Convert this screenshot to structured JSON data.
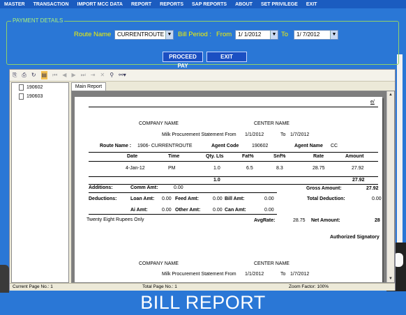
{
  "menu": [
    "MASTER",
    "TRANSACTION",
    "IMPORT MCC DATA",
    "REPORT",
    "REPORTS",
    "SAP REPORTS",
    "ABOUT",
    "SET PRIVILEGE",
    "EXIT"
  ],
  "panel": {
    "legend": "PAYMENT DETAILS",
    "route_label": "Route Name",
    "route_value": "CURRENTROUTE",
    "bill_period_label": "Bill Period :",
    "from_label": "From",
    "from_value": "1/ 1/2012",
    "to_label": "To",
    "to_value": "1/ 7/2012",
    "proceed_label": "PROCEED PAY",
    "exit_label": "EXIT"
  },
  "tree": [
    "190602",
    "190603"
  ],
  "tab": "Main Report",
  "report": {
    "corner_mark": "e/",
    "company": "COMPANY NAME",
    "center": "CENTER NAME",
    "statement_prefix": "Milk Procurement Statement From",
    "from": "1/1/2012",
    "to_word": "To",
    "to": "1/7/2012",
    "route_label": "Route Name :",
    "route_value": "1906- CURRENTROUTE",
    "agent_code_label": "Agent Code",
    "agent_code": "190602",
    "agent_name_label": "Agent Name",
    "agent_name": "CC",
    "columns": [
      "Date",
      "Time",
      "Qty. Lts",
      "Fat%",
      "Snf%",
      "Rate",
      "Amount"
    ],
    "row": [
      "4-Jan-12",
      "PM",
      "1.0",
      "6.5",
      "8.3",
      "28.75",
      "27.92"
    ],
    "total_qty": "1.0",
    "total_amount": "27.92",
    "additions_label": "Additions:",
    "comm_label": "Comm Amt:",
    "comm_value": "0.00",
    "gross_label": "Gross Amount:",
    "gross_value": "27.92",
    "deductions_label": "Deductions:",
    "loan_label": "Loan Amt:",
    "loan_value": "0.00",
    "feed_label": "Feed Amt:",
    "feed_value": "0.00",
    "bill_label": "Bill Amt:",
    "bill_value": "0.00",
    "total_ded_label": "Total Deduction:",
    "total_ded_value": "0.00",
    "ai_label": "Ai Amt:",
    "ai_value": "0.00",
    "other_label": "Other Amt:",
    "other_value": "0.00",
    "can_label": "Can Amt:",
    "can_value": "0.00",
    "words": "Twenty Eight  Rupees Only",
    "avg_label": "AvgRate:",
    "avg_value": "28.75",
    "net_label": "Net Amount:",
    "net_value": "28",
    "signatory": "Authorized Signatory",
    "company2": "COMPANY NAME",
    "center2": "CENTER NAME",
    "statement2": "Milk Procurement Statement From",
    "from2": "1/1/2012",
    "to_word2": "To",
    "to2": "1/7/2012"
  },
  "status": {
    "current": "Current Page No.: 1",
    "total": "Total Page No.: 1",
    "zoom": "Zoom Factor: 100%"
  },
  "caption": "BILL REPORT"
}
